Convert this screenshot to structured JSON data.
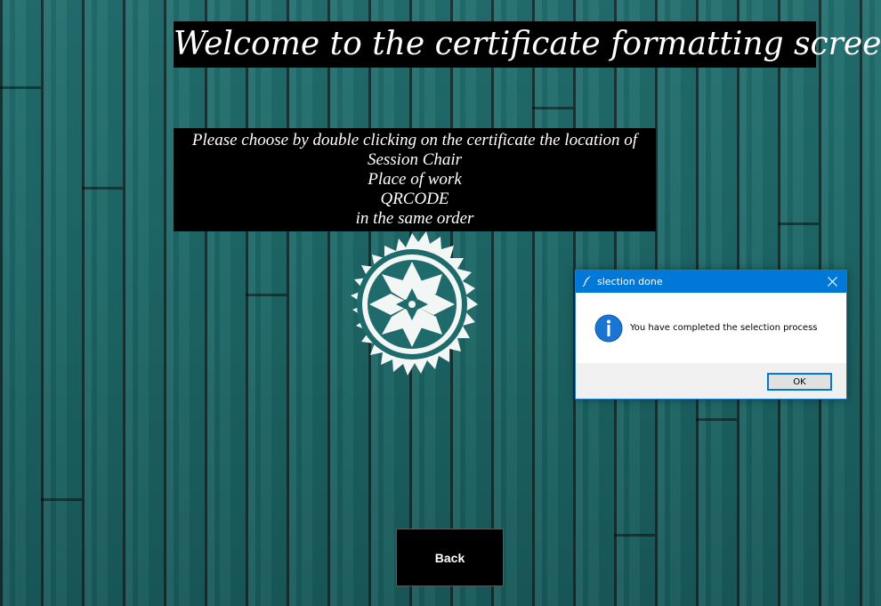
{
  "page": {
    "title": "Welcome to the certificate formatting screen",
    "instructions": [
      "Please choose by double clicking on the certificate the location of",
      "Session Chair",
      "Place of work",
      "QRCODE",
      "in the same order"
    ],
    "emblem_icon": "geometric-star-emblem-icon",
    "back_label": "Back"
  },
  "dialog": {
    "title": "slection done",
    "title_icon": "feather-icon",
    "close_icon": "close-icon",
    "message_icon": "info-icon",
    "message": "You have completed the selection process",
    "ok_label": "OK",
    "accent_color": "#0078d7"
  },
  "colors": {
    "background": "#1f6b6b",
    "panel": "#000000",
    "text": "#ffffff"
  }
}
